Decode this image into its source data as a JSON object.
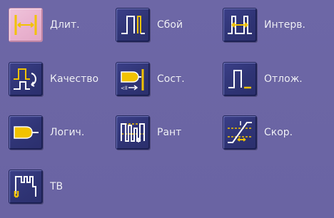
{
  "title": "",
  "items": [
    {
      "label": "Длит.",
      "icon": "width-trigger-icon",
      "selected": true
    },
    {
      "label": "Сбой",
      "icon": "glitch-trigger-icon",
      "selected": false
    },
    {
      "label": "Интерв.",
      "icon": "interval-trigger-icon",
      "selected": false
    },
    {
      "label": "Качество",
      "icon": "qualified-trigger-icon",
      "selected": false
    },
    {
      "label": "Сост.",
      "icon": "state-trigger-icon",
      "selected": false
    },
    {
      "label": "Отлож.",
      "icon": "dropout-trigger-icon",
      "selected": false
    },
    {
      "label": "Логич.",
      "icon": "logic-trigger-icon",
      "selected": false
    },
    {
      "label": "Рант",
      "icon": "runt-trigger-icon",
      "selected": false
    },
    {
      "label": "Скор.",
      "icon": "slew-rate-trigger-icon",
      "selected": false
    },
    {
      "label": "ТВ",
      "icon": "tv-trigger-icon",
      "selected": false
    }
  ],
  "colors": {
    "background": "#6d67a6",
    "tile": "#2f3475",
    "tile_selected": "#e9b2cf",
    "accent": "#f2c200",
    "line": "#ffffff"
  }
}
